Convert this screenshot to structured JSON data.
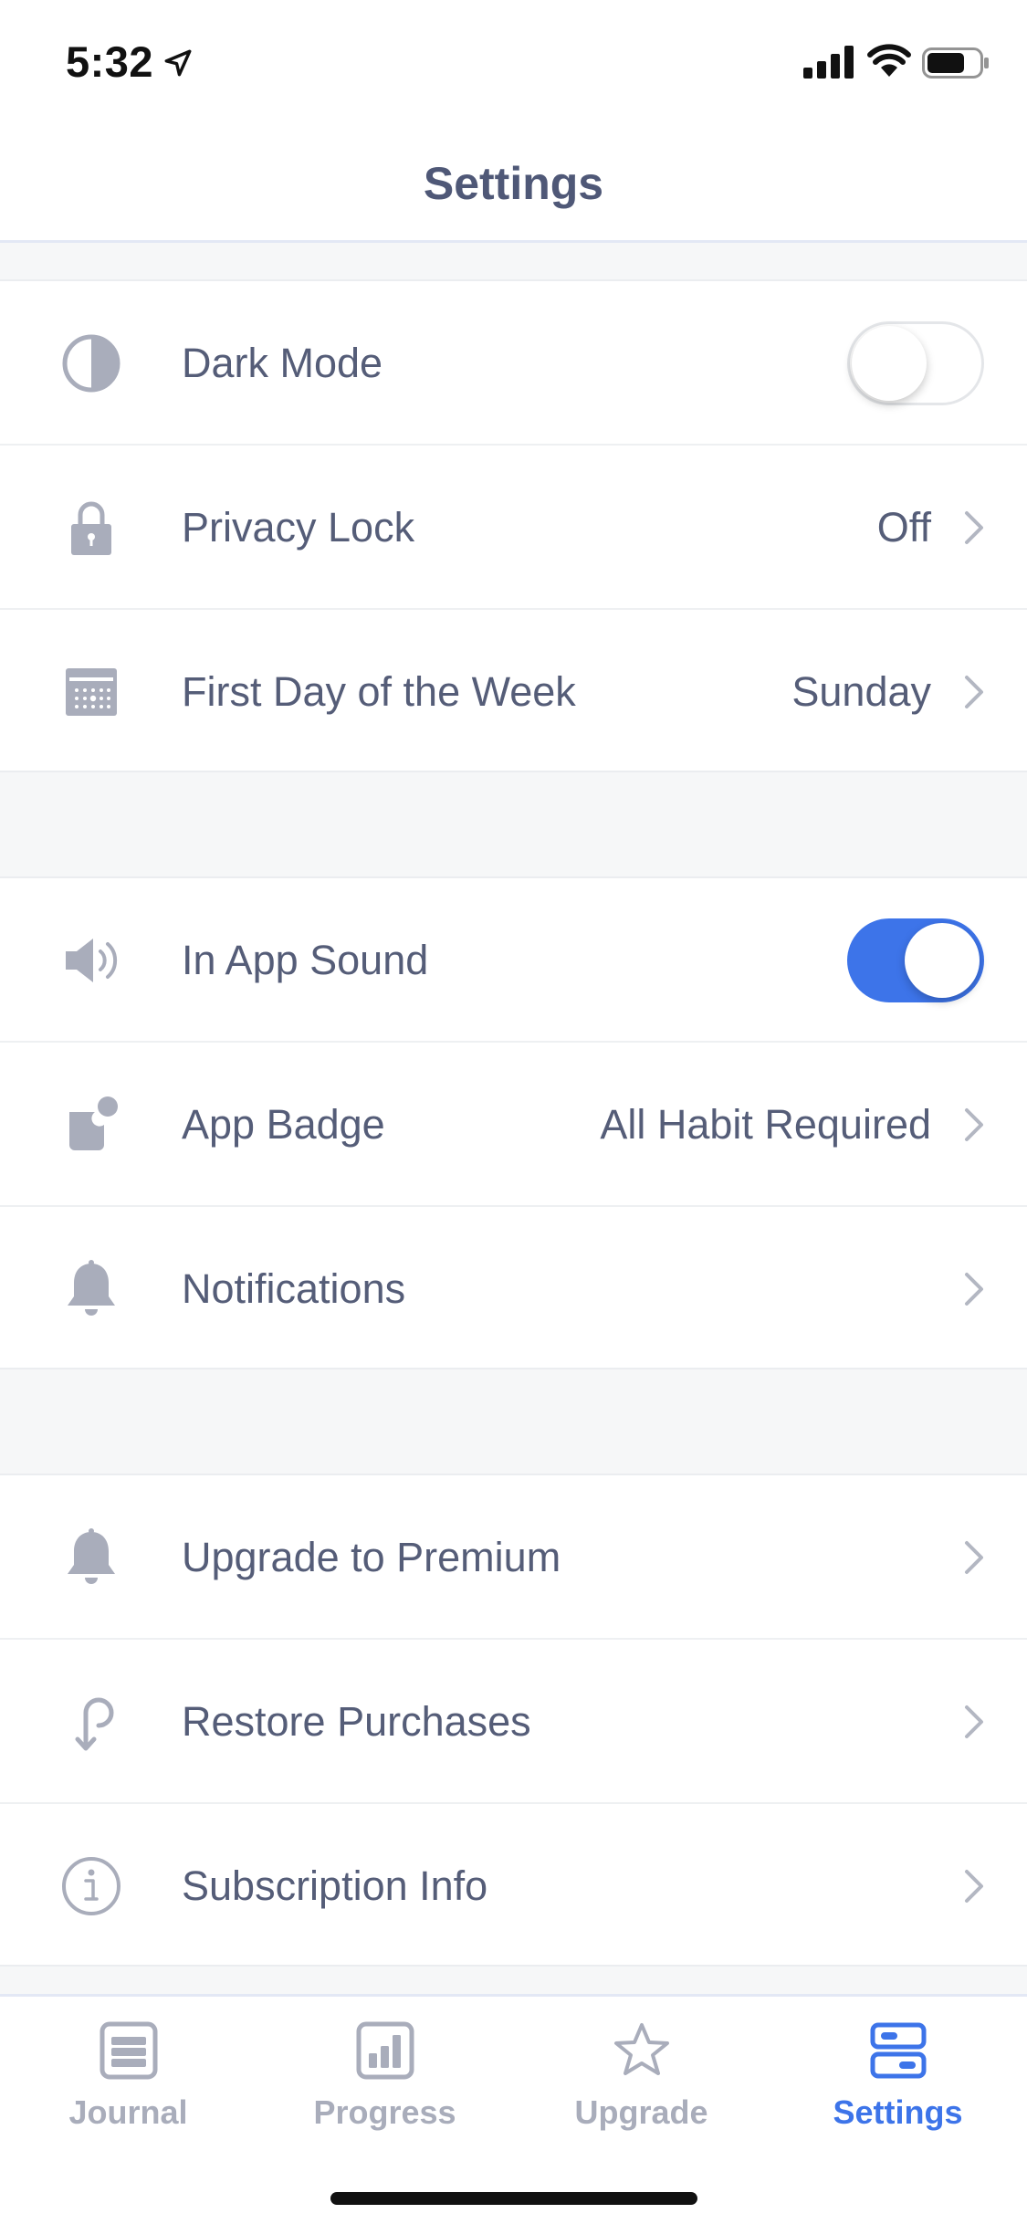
{
  "status_bar": {
    "time": "5:32"
  },
  "header": {
    "title": "Settings"
  },
  "colors": {
    "accent": "#3d74e9",
    "icon_gray": "#a9adbb",
    "text": "#555d78"
  },
  "groups": [
    {
      "rows": [
        {
          "label": "Dark Mode",
          "icon": "contrast-icon",
          "type": "toggle",
          "on": false
        },
        {
          "label": "Privacy Lock",
          "icon": "lock-icon",
          "value": "Off",
          "type": "link"
        },
        {
          "label": "First Day of the Week",
          "icon": "calendar-icon",
          "value": "Sunday",
          "type": "link"
        }
      ]
    },
    {
      "rows": [
        {
          "label": "In App Sound",
          "icon": "speaker-icon",
          "type": "toggle",
          "on": true
        },
        {
          "label": "App Badge",
          "icon": "badge-icon",
          "value": "All Habit Required",
          "type": "link"
        },
        {
          "label": "Notifications",
          "icon": "bell-icon",
          "type": "link"
        }
      ]
    },
    {
      "rows": [
        {
          "label": "Upgrade to Premium",
          "icon": "bell-icon",
          "type": "link"
        },
        {
          "label": "Restore Purchases",
          "icon": "restore-icon",
          "type": "link"
        },
        {
          "label": "Subscription Info",
          "icon": "info-icon",
          "type": "link"
        }
      ]
    }
  ],
  "tabs": [
    {
      "label": "Journal",
      "icon": "journal-icon",
      "active": false
    },
    {
      "label": "Progress",
      "icon": "progress-icon",
      "active": false
    },
    {
      "label": "Upgrade",
      "icon": "star-icon",
      "active": false
    },
    {
      "label": "Settings",
      "icon": "settings-icon",
      "active": true
    }
  ]
}
